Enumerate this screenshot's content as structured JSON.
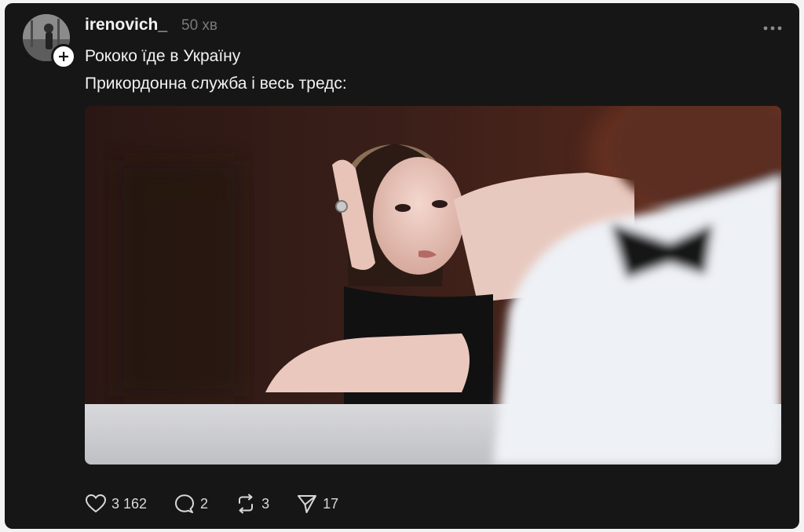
{
  "post": {
    "username": "irenovich_",
    "time": "50 хв",
    "line1": "Рококо їде в Україну",
    "line2": "Прикордонна служба і весь тредс:",
    "image_alt": "Жінка з рукою біля голови, на передньому плані розмитий чоловік у білій сорочці з метеликом"
  },
  "actions": {
    "likes": "3 162",
    "comments": "2",
    "reposts": "3",
    "shares": "17"
  },
  "icons": {
    "more": "more-icon",
    "follow": "plus-icon",
    "like": "heart-icon",
    "comment": "comment-icon",
    "repost": "repost-icon",
    "share": "send-icon"
  },
  "colors": {
    "background": "#161616",
    "text": "#f2f2f2",
    "muted": "#7a7a7a"
  }
}
